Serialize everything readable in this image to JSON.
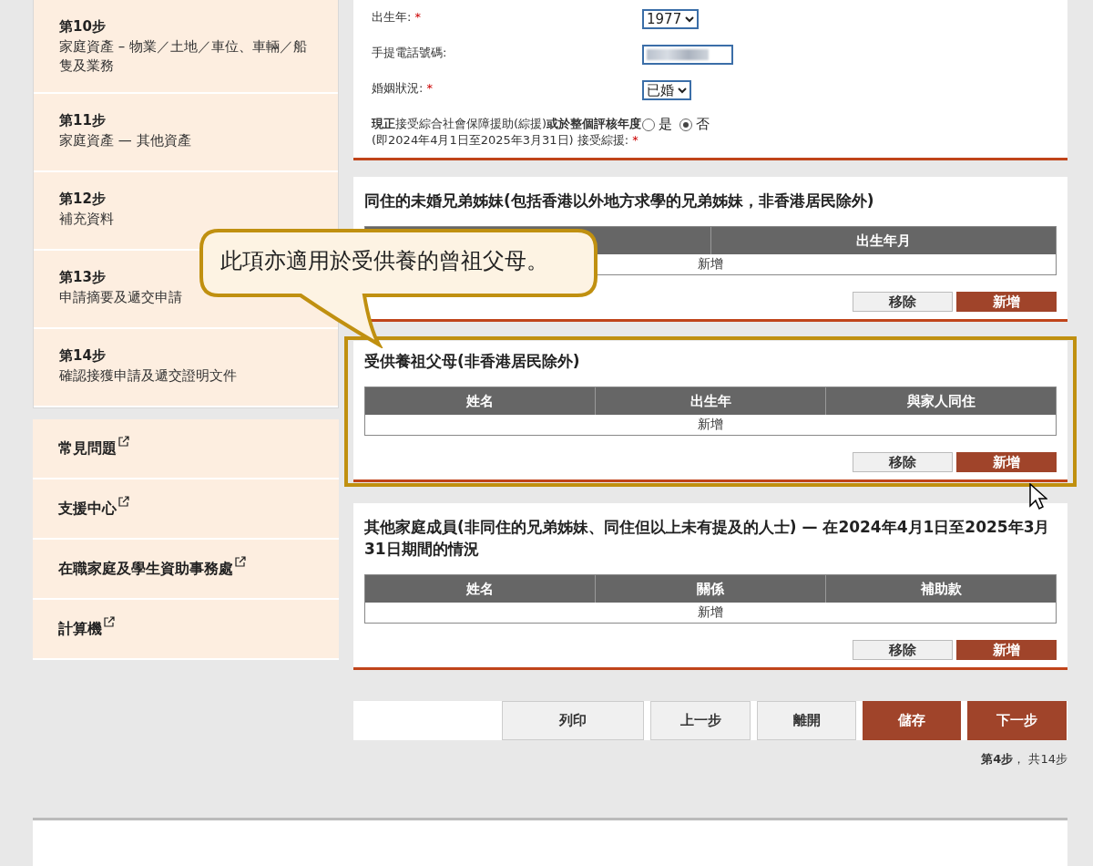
{
  "sidebar": {
    "steps": [
      {
        "step": "第10步",
        "title": "家庭資產 – 物業／土地／車位、車輛／船隻及業務"
      },
      {
        "step": "第11步",
        "title": "家庭資產 — 其他資產"
      },
      {
        "step": "第12步",
        "title": "補充資料"
      },
      {
        "step": "第13步",
        "title": "申請摘要及遞交申請"
      },
      {
        "step": "第14步",
        "title": "確認接獲申請及遞交證明文件"
      }
    ],
    "links": [
      {
        "label": "常見問題"
      },
      {
        "label": "支援中心"
      },
      {
        "label": "在職家庭及學生資助事務處"
      },
      {
        "label": "計算機"
      }
    ]
  },
  "personal_fields": [
    {
      "kind": "select",
      "label": "出生年:",
      "mark": "*",
      "value": "1977"
    },
    {
      "kind": "text",
      "label": "手提電話號碼:"
    },
    {
      "kind": "select",
      "label": "婚姻狀況:",
      "mark": "*",
      "value": "已婚"
    },
    {
      "kind": "radio",
      "label": "**現正**接受綜合社會保障援助(綜援)**或於整個評核年度**(即2024年4月1日至2025年3月31日) 接受綜援:",
      "mark": "*",
      "options": [
        {
          "label": "是",
          "selected": false
        },
        {
          "label": "否",
          "selected": true
        }
      ]
    }
  ],
  "sections": [
    {
      "title": "同住的未婚兄弟姊妹(包括香港以外地方求學的兄弟姊妹，非香港居民除外)",
      "highlighted": false,
      "columns": [
        {},
        {
          "label": "出生年月"
        }
      ],
      "empty_row": "新增",
      "buttons": [
        {
          "label": "移除",
          "kind": "secondary"
        },
        {
          "label": "新增",
          "kind": "primary"
        }
      ]
    },
    {
      "title": "受供養祖父母(非香港居民除外)",
      "highlighted": true,
      "columns": [
        {
          "label": "姓名"
        },
        {
          "label": "出生年"
        },
        {
          "label": "與家人同住"
        }
      ],
      "empty_row": "新增",
      "buttons": [
        {
          "label": "移除",
          "kind": "secondary"
        },
        {
          "label": "新增",
          "kind": "primary"
        }
      ]
    },
    {
      "title": "其他家庭成員(非同住的兄弟姊妹、同住但以上未有提及的人士) — 在2024年4月1日至2025年3月31日期間的情況",
      "highlighted": false,
      "columns": [
        {
          "label": "姓名"
        },
        {
          "label": "關係"
        },
        {
          "label": "補助款"
        }
      ],
      "empty_row": "新增",
      "buttons": [
        {
          "label": "移除",
          "kind": "secondary"
        },
        {
          "label": "新增",
          "kind": "primary"
        }
      ]
    }
  ],
  "nav_buttons": [
    {
      "label": "列印",
      "kind": "secondary"
    },
    {
      "label": "上一步",
      "kind": "secondary"
    },
    {
      "label": "離開",
      "kind": "secondary"
    },
    {
      "label": "儲存",
      "kind": "primary"
    },
    {
      "label": "下一步",
      "kind": "primary"
    }
  ],
  "step_counter": "**第4步**， 共14步",
  "callout": "此項亦適用於受供養的曾祖父母。"
}
